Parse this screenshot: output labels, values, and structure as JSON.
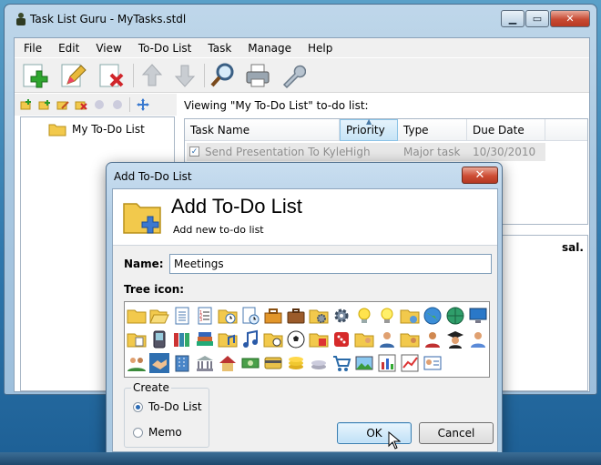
{
  "window": {
    "title": "Task List Guru - MyTasks.stdl"
  },
  "menu": [
    "File",
    "Edit",
    "View",
    "To-Do List",
    "Task",
    "Manage",
    "Help"
  ],
  "toolbar": {
    "icons": [
      "add-task-icon",
      "edit-task-icon",
      "delete-task-icon",
      "move-up-icon",
      "move-down-icon",
      "search-icon",
      "print-icon",
      "settings-wrench-icon"
    ]
  },
  "tree": {
    "item": "My To-Do List"
  },
  "viewing_text": "Viewing \"My To-Do List\" to-do list:",
  "grid": {
    "headers": [
      "Task Name",
      "Priority",
      "Type",
      "Due Date"
    ],
    "rows": [
      {
        "name": "Send Presentation To Kyle",
        "priority": "High",
        "type": "Major task",
        "due": "10/30/2010",
        "checked": true
      }
    ]
  },
  "desc_fragment": "sal.",
  "dialog": {
    "title": "Add To-Do List",
    "heading": "Add To-Do List",
    "subheading": "Add new to-do list",
    "name_label": "Name:",
    "name_value": "Meetings",
    "tree_icon_label": "Tree icon:",
    "create_label": "Create",
    "options": [
      "To-Do List",
      "Memo"
    ],
    "selected_option": "To-Do List",
    "ok": "OK",
    "cancel": "Cancel"
  },
  "colors": {
    "accent": "#2a6bb5",
    "title_bar": "#a9c8e1",
    "close": "#c74a33"
  }
}
